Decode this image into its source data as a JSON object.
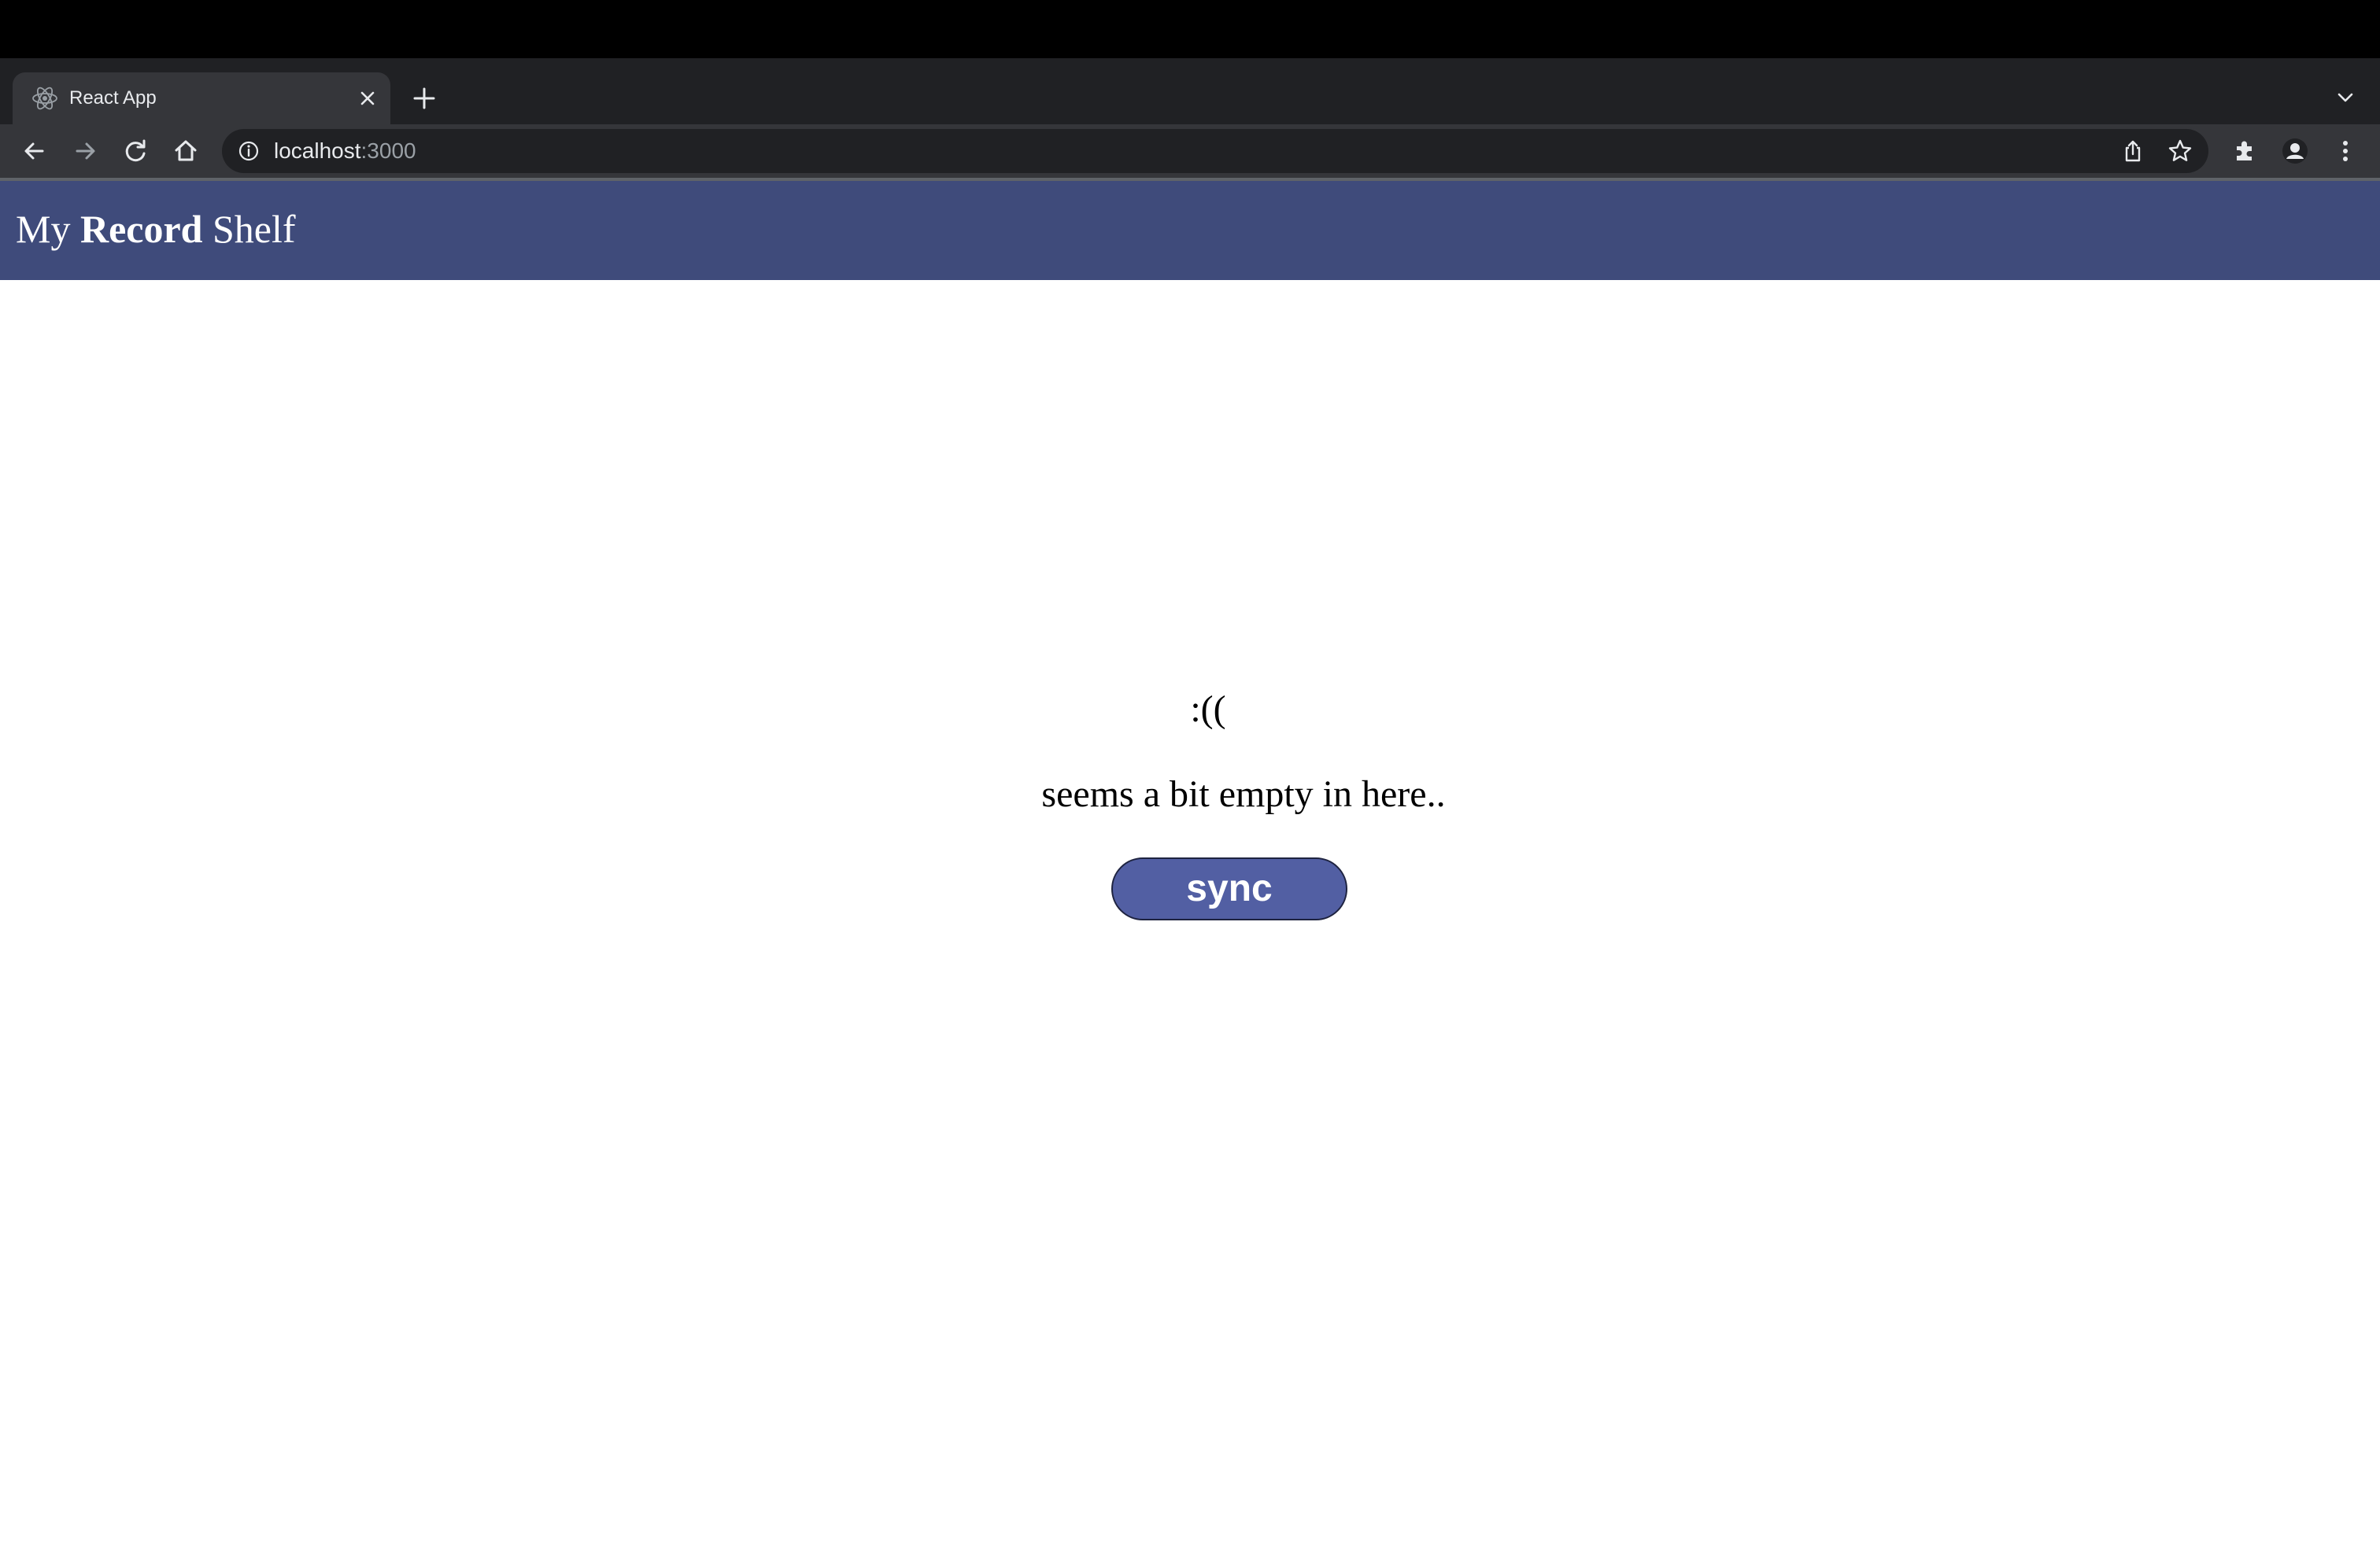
{
  "browser": {
    "tab": {
      "title": "React App",
      "favicon_icon": "react-logo-icon",
      "close_icon": "close-icon"
    },
    "new_tab_icon": "plus-icon",
    "tab_search_icon": "chevron-down-icon",
    "toolbar": {
      "back_icon": "arrow-left-icon",
      "forward_icon": "arrow-right-icon",
      "reload_icon": "reload-icon",
      "home_icon": "home-icon",
      "extensions_icon": "puzzle-icon",
      "profile_icon": "person-icon",
      "menu_icon": "kebab-menu-icon"
    },
    "omnibox": {
      "info_icon": "info-icon",
      "host": "localhost",
      "port": ":3000",
      "share_icon": "share-icon",
      "bookmark_icon": "star-icon"
    },
    "colors": {
      "frame": "#202124",
      "toolbar": "#35363a"
    }
  },
  "app": {
    "header": {
      "title_prefix": "My ",
      "title_bold": "Record",
      "title_suffix": " Shelf"
    },
    "empty_state": {
      "emoticon": ":((",
      "message": "seems a bit empty in here..",
      "sync_label": "sync"
    },
    "colors": {
      "header_bg": "#3f4b7b",
      "button_bg": "#525fa3"
    }
  }
}
